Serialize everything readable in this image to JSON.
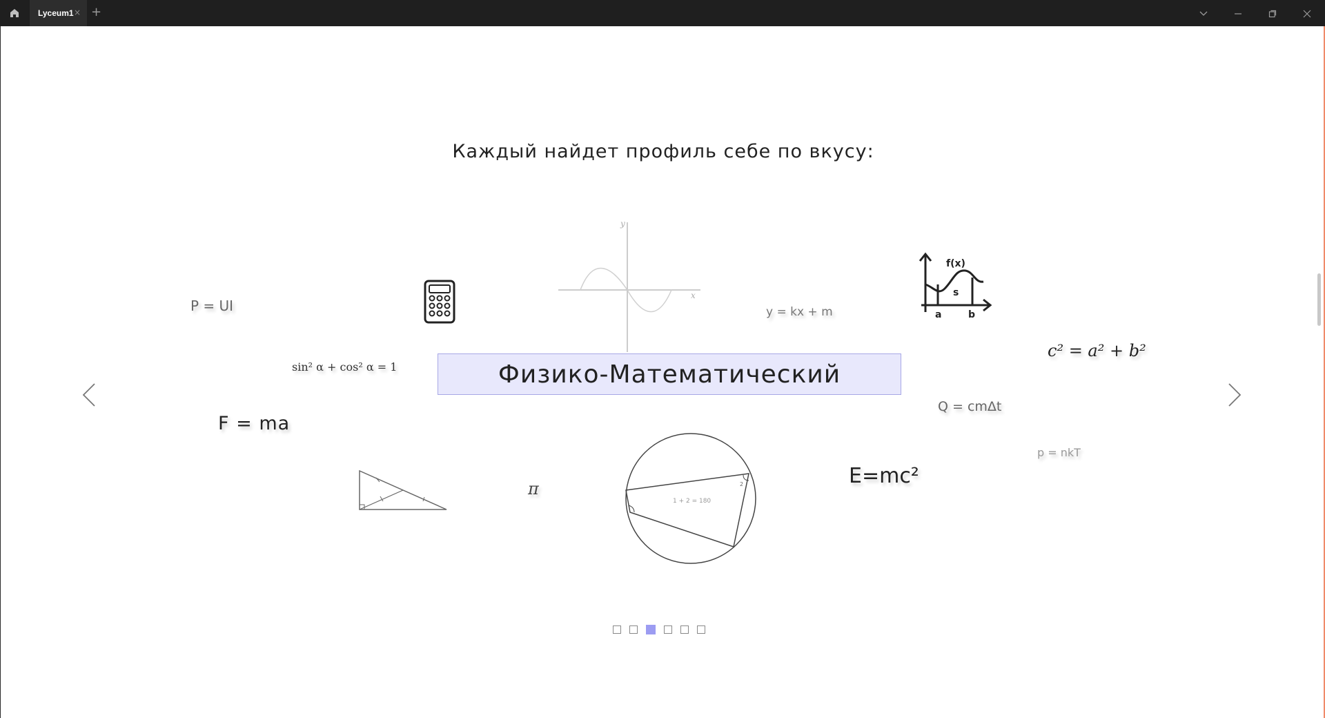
{
  "window": {
    "tab_title": "Lyceum1",
    "tab_close": "×",
    "new_tab": "+"
  },
  "content": {
    "heading": "Каждый найдет профиль себе по вкусу:",
    "profile_banner": "Физико-Математический",
    "formulas": {
      "power": "P = UI",
      "trig_identity": "sin² α + cos² α = 1",
      "newton": "F = ma",
      "pi": "π",
      "linear": "y = kx + m",
      "pythagoras": "c² = a² + b²",
      "heat": "Q = cmΔt",
      "pressure": "p = nkT",
      "einstein": "E=mc²"
    },
    "graph_labels": {
      "y_axis": "y",
      "x_axis": "x"
    },
    "circle_note": "1 + 2 = 180",
    "circle_angle_mark": "2",
    "integral_icon": {
      "func": "f(x)",
      "area": "s",
      "left": "a",
      "right": "b"
    }
  },
  "carousel": {
    "slide_count": 6,
    "active_slide": 3
  },
  "colors": {
    "banner_bg": "#e8e8fc",
    "banner_border": "#a7a7e6",
    "active_dot": "#9c9cf2",
    "titlebar": "#1f1f1f"
  },
  "icons": [
    "home-icon",
    "calculator-icon",
    "integral-graph-icon",
    "chevron-left-icon",
    "chevron-right-icon",
    "minimize-icon",
    "maximize-icon",
    "close-icon",
    "chevron-down-icon"
  ]
}
